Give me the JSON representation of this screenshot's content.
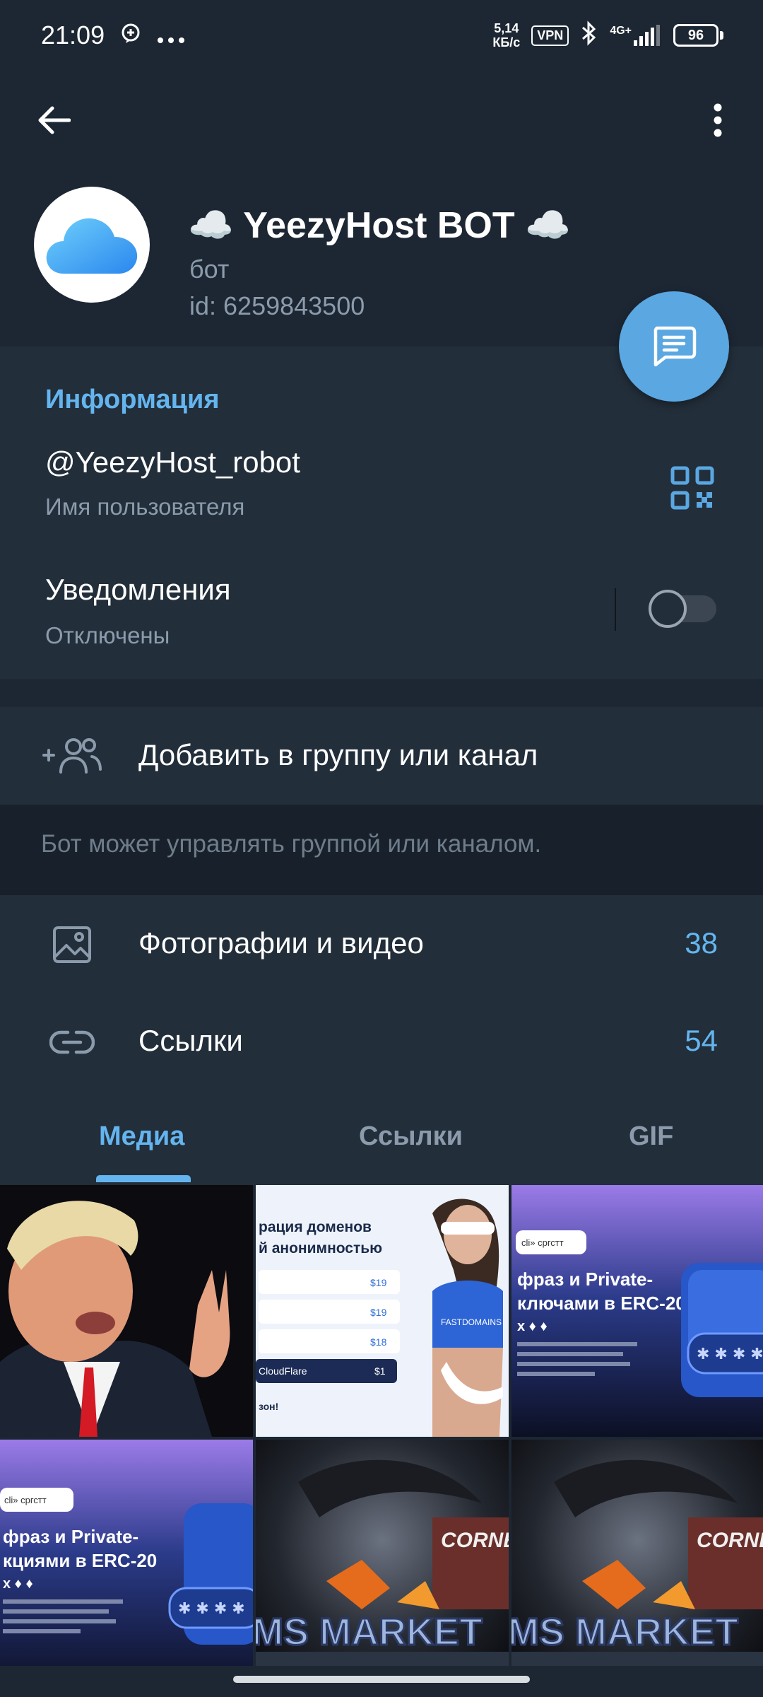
{
  "status_bar": {
    "time": "21:09",
    "speed_value": "5,14",
    "speed_unit": "КБ/с",
    "vpn": "VPN",
    "network": "4G+",
    "battery": "96"
  },
  "profile": {
    "title": "☁️ YeezyHost BOT ☁️",
    "subtitle": "бот",
    "id_line": "id: 6259843500"
  },
  "info": {
    "section_title": "Информация",
    "username": "@YeezyHost_robot",
    "username_caption": "Имя пользователя",
    "notifications_label": "Уведомления",
    "notifications_status": "Отключены",
    "notifications_enabled": false
  },
  "actions": {
    "add_to_group": "Добавить в группу или канал",
    "hint": "Бот может управлять группой или каналом."
  },
  "shared": {
    "photos_label": "Фотографии и видео",
    "photos_count": "38",
    "links_label": "Ссылки",
    "links_count": "54"
  },
  "tabs": [
    {
      "label": "Медиа",
      "active": true
    },
    {
      "label": "Ссылки",
      "active": false
    },
    {
      "label": "GIF",
      "active": false
    }
  ],
  "media_text": {
    "domains_line1": "рация доменов",
    "domains_line2": "й анонимностью",
    "price1": "$19",
    "price2": "$19",
    "price3": "$18",
    "cloudflare": "CloudFlare",
    "cloudflare_price": "$1",
    "domains_footer": "зон!",
    "brand": "FASTDOMAINS",
    "erc_tag": "cli» сргстт",
    "erc_line1": "фраз и Private-",
    "erc_line2": "ключами в ERC-20",
    "erc_line3": "х ♦ ♦",
    "erc2_line2": "кциями в ERC-20",
    "market": "MS MARKET",
    "corner": "CORNE"
  },
  "colors": {
    "background": "#1d2733",
    "section": "#222e3a",
    "accent": "#64b5ef",
    "fab": "#5aa7e2",
    "secondary_text": "#8b9bab"
  }
}
